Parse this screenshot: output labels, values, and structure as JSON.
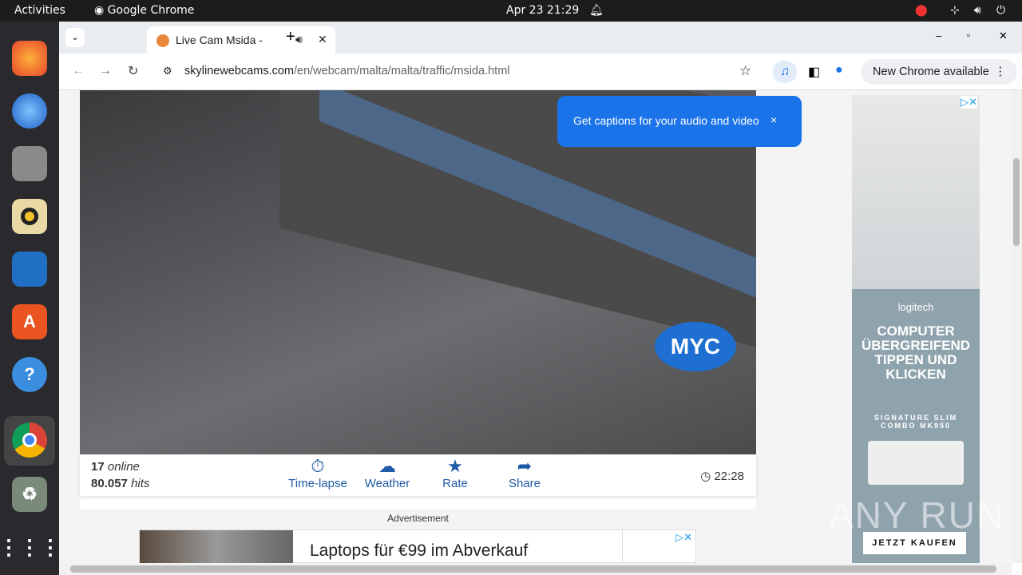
{
  "system": {
    "activities": "Activities",
    "app_name": "Google Chrome",
    "datetime": "Apr 23  21:29"
  },
  "dock": {
    "items": [
      "firefox",
      "thunderbird",
      "files",
      "rhythmbox",
      "writer",
      "app-center",
      "help",
      "chrome",
      "trash",
      "show-apps"
    ]
  },
  "browser": {
    "tab_title": "Live Cam Msida - Traffic",
    "url_domain": "skylinewebcams.com",
    "url_path": "/en/webcam/malta/malta/traffic/msida.html",
    "update_label": "New Chrome available"
  },
  "popup": {
    "text": "Get captions for your audio and video",
    "close": "×"
  },
  "cam": {
    "watermark": "MYC",
    "online_count": "17",
    "online_label": "online",
    "hits_count": "80.057",
    "hits_label": "hits",
    "time": "22:28",
    "actions": [
      {
        "label": "Time-lapse",
        "icon": "⏱"
      },
      {
        "label": "Weather",
        "icon": "☁"
      },
      {
        "label": "Rate",
        "icon": "★"
      },
      {
        "label": "Share",
        "icon": "➦"
      }
    ]
  },
  "ad": {
    "label": "Advertisement",
    "headline": "Laptops für €99 im Abverkauf"
  },
  "side_ad": {
    "brand": "logitech",
    "headline": "COMPUTER ÜBERGREIFEND TIPPEN UND KLICKEN",
    "product": "SIGNATURE SLIM COMBO MK950",
    "cta": "JETZT KAUFEN"
  },
  "overlay": {
    "watermark": "ANY RUN"
  }
}
